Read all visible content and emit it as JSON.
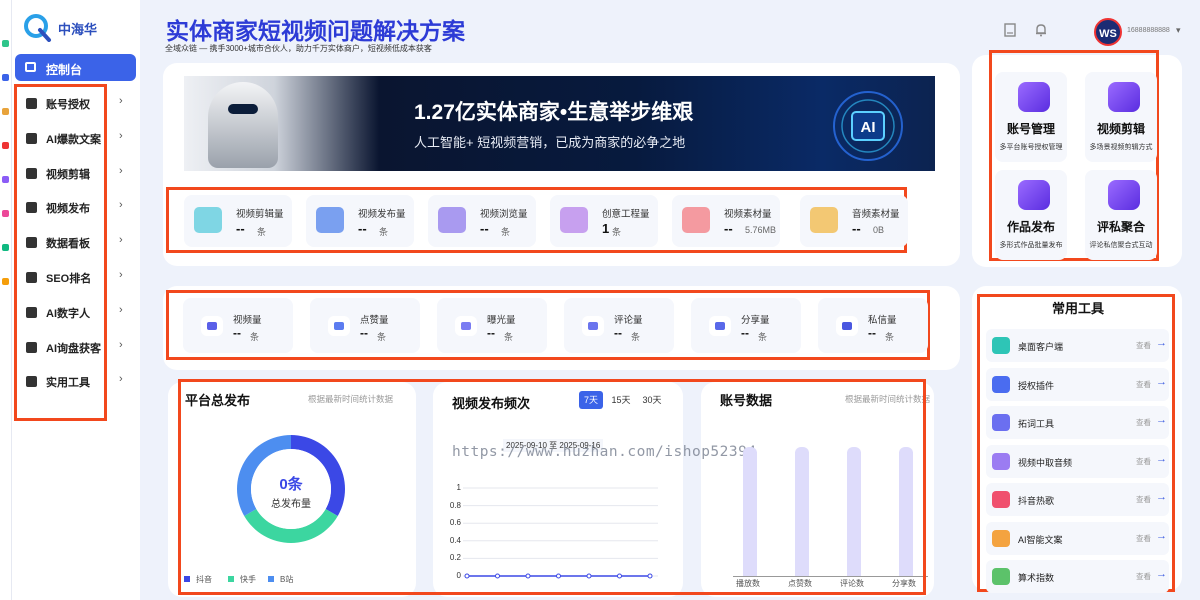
{
  "brand": {
    "name": "中海华",
    "logo_letter": "Q"
  },
  "sidebar": {
    "active": {
      "label": "控制台",
      "icon": "monitor-icon"
    },
    "items": [
      {
        "label": "账号授权",
        "icon": "shield-icon"
      },
      {
        "label": "AI爆款文案",
        "icon": "lightbulb-icon"
      },
      {
        "label": "视频剪辑",
        "icon": "video-icon"
      },
      {
        "label": "视频发布",
        "icon": "video-publish-icon"
      },
      {
        "label": "数据看板",
        "icon": "dashboard-icon"
      },
      {
        "label": "SEO排名",
        "icon": "bar-chart-icon"
      },
      {
        "label": "AI数字人",
        "icon": "person-icon"
      },
      {
        "label": "AI询盘获客",
        "icon": "headset-icon"
      },
      {
        "label": "实用工具",
        "icon": "toolbox-icon"
      }
    ],
    "chevron": "›"
  },
  "header": {
    "title": "实体商家短视频问题解决方案",
    "subtitle": "全域众链 — 携手3000+城市合伙人，助力千万实体商户，短视频低成本获客",
    "icons": [
      "book-icon",
      "bell-icon"
    ],
    "avatar_text": "WS",
    "phone": "16888888888",
    "caret": "▾"
  },
  "banner": {
    "headline": "1.27亿实体商家•生意举步维艰",
    "subline": "人工智能+ 短视频营销，已成为商家的必争之地",
    "ai_text": "AI"
  },
  "stats_top": [
    {
      "label": "视频剪辑量",
      "value": "--",
      "unit": "条",
      "color": "#7fd6e4"
    },
    {
      "label": "视频发布量",
      "value": "--",
      "unit": "条",
      "color": "#7aa0f0"
    },
    {
      "label": "视频浏览量",
      "value": "--",
      "unit": "条",
      "color": "#a99af0"
    },
    {
      "label": "创意工程量",
      "value": "1",
      "unit": "条",
      "color": "#c7a0ef"
    },
    {
      "label": "视频素材量",
      "value": "--",
      "unit": "5.76MB",
      "color": "#f49aa0"
    },
    {
      "label": "音频素材量",
      "value": "--",
      "unit": "0B",
      "color": "#f3c873"
    }
  ],
  "stats_second": [
    {
      "label": "视频量",
      "value": "--",
      "unit": "条",
      "color": "#5a5fe8"
    },
    {
      "label": "点赞量",
      "value": "--",
      "unit": "条",
      "color": "#5c7cf0"
    },
    {
      "label": "曝光量",
      "value": "--",
      "unit": "条",
      "color": "#7a7cf2"
    },
    {
      "label": "评论量",
      "value": "--",
      "unit": "条",
      "color": "#6a74ee"
    },
    {
      "label": "分享量",
      "value": "--",
      "unit": "条",
      "color": "#5968e9"
    },
    {
      "label": "私信量",
      "value": "--",
      "unit": "条",
      "color": "#4a57e0"
    }
  ],
  "quick_actions": [
    {
      "title": "账号管理",
      "desc": "多平台账号授权管理"
    },
    {
      "title": "视频剪辑",
      "desc": "多场景视频剪辑方式"
    },
    {
      "title": "作品发布",
      "desc": "多形式作品批量发布"
    },
    {
      "title": "评私聚合",
      "desc": "评论私信聚合式互动"
    }
  ],
  "tools": {
    "title": "常用工具",
    "view_label": "查看",
    "arrow": "→",
    "items": [
      {
        "label": "桌面客户端",
        "color": "#2ec5b6"
      },
      {
        "label": "授权插件",
        "color": "#4a6cf0"
      },
      {
        "label": "拓词工具",
        "color": "#6b6ff0"
      },
      {
        "label": "视频中取音频",
        "color": "#9b7cf2"
      },
      {
        "label": "抖音热歌",
        "color": "#f0506e"
      },
      {
        "label": "AI智能文案",
        "color": "#f4a340"
      },
      {
        "label": "算术指数",
        "color": "#5cc26a"
      }
    ]
  },
  "platform_dist": {
    "title": "平台总发布",
    "note": "根据最新时间统计数据",
    "center_value": "0条",
    "center_label": "总发布量",
    "legend": [
      {
        "name": "抖音",
        "color": "#3b48e6"
      },
      {
        "name": "快手",
        "color": "#3cd6a0"
      },
      {
        "name": "B站",
        "color": "#4d8ef0"
      }
    ]
  },
  "frequency": {
    "title": "视频发布频次",
    "tabs": [
      "7天",
      "15天",
      "30天"
    ],
    "active_tab": "7天",
    "date_range": "2025-09-10 至 2025-09-16"
  },
  "account_data": {
    "title": "账号数据",
    "note": "根据最新时间统计数据"
  },
  "chart_data": [
    {
      "type": "pie",
      "title": "平台总发布",
      "categories": [
        "抖音",
        "快手",
        "B站"
      ],
      "values": [
        0,
        0,
        0
      ]
    },
    {
      "type": "line",
      "title": "视频发布频次",
      "x": [
        "",
        "",
        "",
        "",
        "",
        "",
        ""
      ],
      "values": [
        0,
        0,
        0,
        0,
        0,
        0,
        0
      ],
      "ylim": [
        0,
        1
      ],
      "yticks": [
        "1",
        "0.8",
        "0.6",
        "0.4",
        "0.2",
        "0"
      ]
    },
    {
      "type": "bar",
      "title": "账号数据",
      "categories": [
        "播放数",
        "点赞数",
        "评论数",
        "分享数"
      ],
      "values": [
        0,
        0,
        0,
        0
      ]
    }
  ],
  "watermark": "https://www.huzhan.com/ishop52394",
  "colors": {
    "accent": "#3b63e8",
    "title": "#2d3bd6",
    "highlight": "#f2481d"
  }
}
